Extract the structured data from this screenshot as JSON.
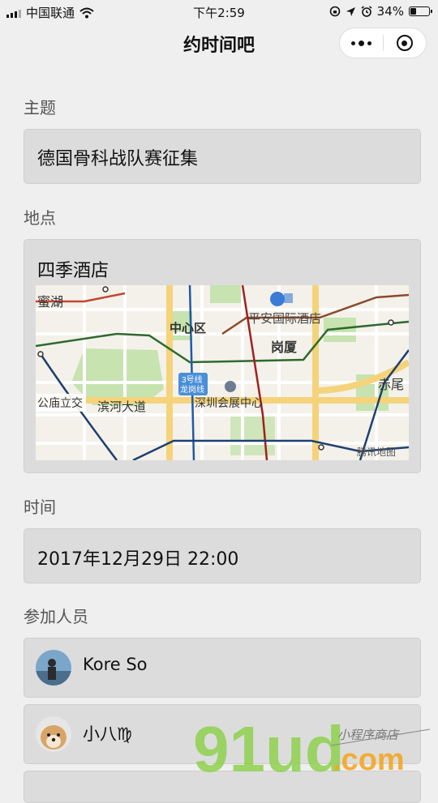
{
  "status_bar": {
    "carrier": "中国联通",
    "time": "下午2:59",
    "battery_percent": "34%",
    "battery_level": 0.34
  },
  "nav": {
    "title": "约时间吧"
  },
  "form": {
    "topic": {
      "label": "主题",
      "value": "德国骨科战队赛征集"
    },
    "location": {
      "label": "地点",
      "value": "四季酒店",
      "map_labels": {
        "area_top_left": "蜜湖",
        "center_district": "中心区",
        "hotel": "平安国际酒店",
        "district_gangxia": "岗厦",
        "metro_line": "3号线",
        "metro_line_sub": "龙岗线",
        "interchange": "公庙立交",
        "road": "滨河大道",
        "convention_center": "深圳会展中心",
        "area_right": "赤尾",
        "attribution": "腾讯地图"
      }
    },
    "time": {
      "label": "时间",
      "value": "2017年12月29日 22:00"
    },
    "participants": {
      "label": "参加人员",
      "people": [
        {
          "name": "Kore So"
        },
        {
          "name": "小八♍"
        }
      ]
    }
  },
  "watermark": {
    "brand": "91ud",
    "domain": ".com",
    "slogan": "小程序商店"
  },
  "colors": {
    "page_bg": "#efefef",
    "field_bg": "#dcdcdc",
    "map_green": "#c6e3b0",
    "map_road_yellow": "#f5d37a",
    "watermark_green": "#8fd14f",
    "watermark_orange": "#f5a623"
  }
}
